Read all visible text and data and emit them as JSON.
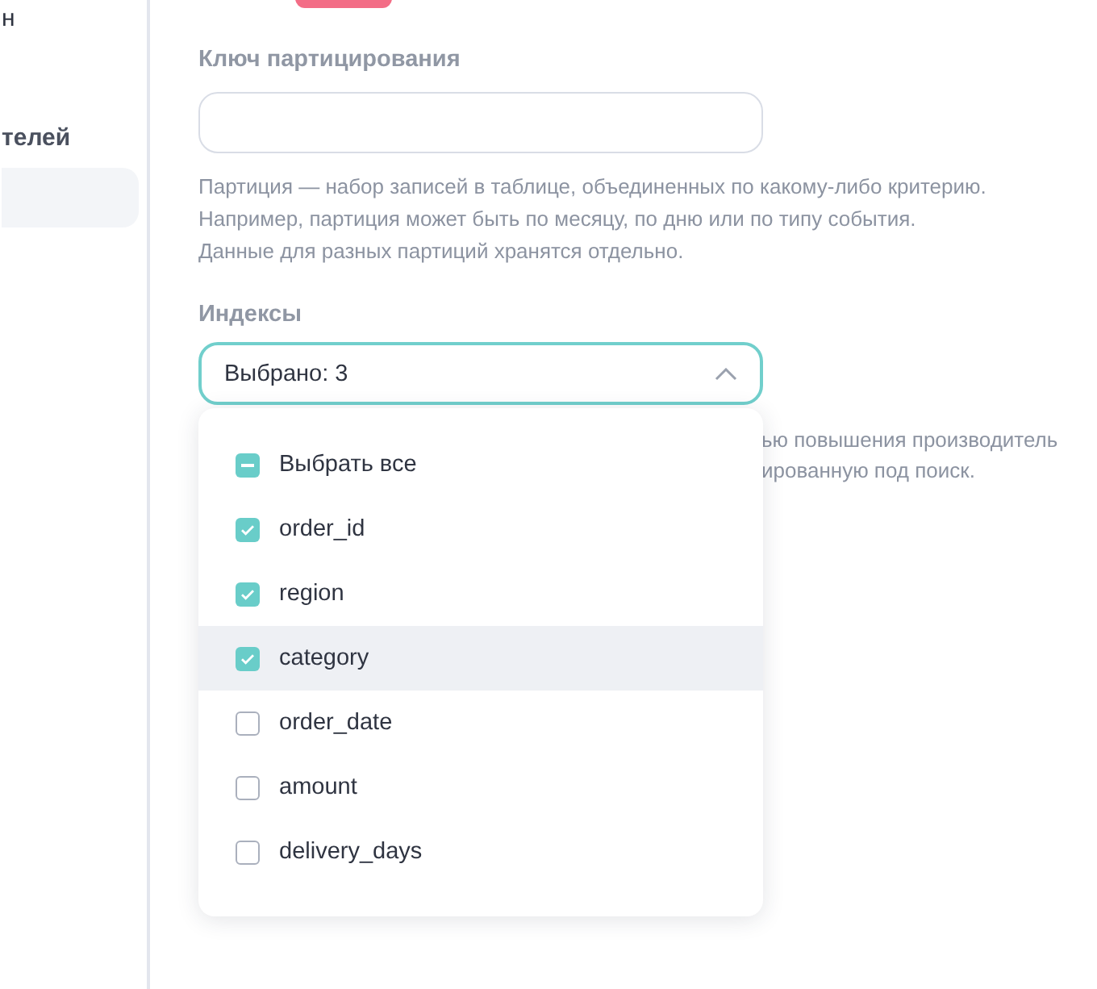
{
  "sidebar": {
    "items": [
      {
        "label": "н",
        "kind": "plain",
        "selected": false
      },
      {
        "label": "телей",
        "kind": "heading",
        "selected": false
      },
      {
        "kind": "blank",
        "selected": true
      }
    ]
  },
  "partition_key": {
    "label": "Ключ партицирования",
    "description": [
      "Партиция — набор записей в таблице, объединенных по какому-либо критерию.",
      "Например, партиция может быть по месяцу, по дню или по типу события.",
      "Данные для разных партиций хранятся отдельно."
    ]
  },
  "indexes": {
    "label": "Индексы",
    "value": "Выбрано: 3",
    "expanded": true,
    "hint_visible": [
      "ью повышения производитель",
      "ированную под поиск."
    ],
    "select_all": {
      "label": "Выбрать все",
      "partial": true
    },
    "options": [
      {
        "label": "order_id",
        "checked": true,
        "highlighted": false
      },
      {
        "label": "region",
        "checked": true,
        "highlighted": false
      },
      {
        "label": "category",
        "checked": true,
        "highlighted": true
      },
      {
        "label": "order_date",
        "checked": false,
        "highlighted": false
      },
      {
        "label": "amount",
        "checked": false,
        "highlighted": false
      },
      {
        "label": "delivery_days",
        "checked": false,
        "highlighted": false
      }
    ]
  }
}
